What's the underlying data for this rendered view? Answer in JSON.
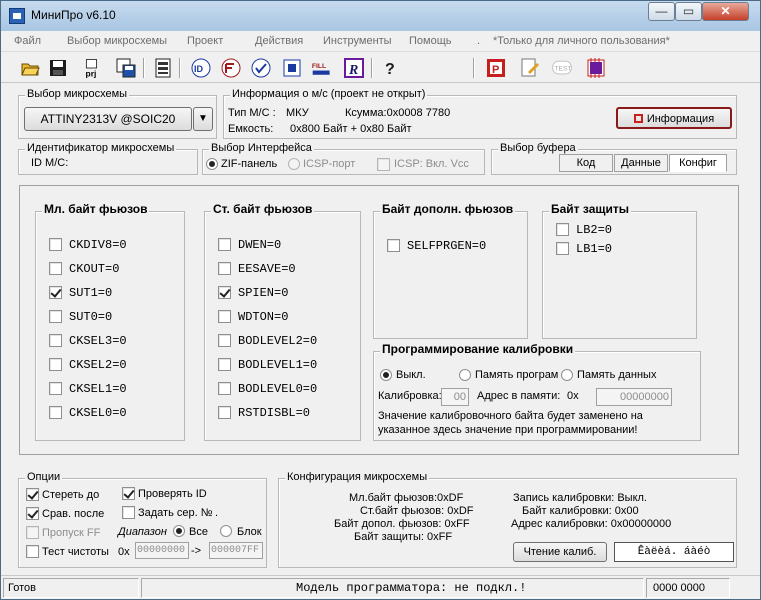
{
  "window": {
    "title": "МиниПро v6.10",
    "controls": {
      "minimize": "—",
      "maximize": "▭",
      "close": "✕"
    }
  },
  "menu": [
    "Файл",
    "Выбор микросхемы",
    "Проект",
    "Действия",
    "Инструменты",
    "Помощь",
    ".",
    "*Только для личного пользования*"
  ],
  "toolbar": {
    "icons": [
      "open-icon",
      "save-icon",
      "project-icon",
      "save-as-icon",
      "chip-info-icon",
      "read-id-icon",
      "read-icon",
      "verify-icon",
      "program-icon",
      "fill-icon",
      "read-protect-icon",
      "help-icon",
      "prog-mode-icon",
      "edit-icon",
      "test-icon",
      "chip-test-icon"
    ],
    "labels": {
      "prj": "prj",
      "fill": "FILL",
      "read_letter": "R",
      "help_mark": "?",
      "p_letter": "P",
      "test": "TEST",
      "id": "ID"
    }
  },
  "chip_select": {
    "label": "Выбор микросхемы",
    "value": "ATTINY2313V @SOIC20",
    "dropdown_arrow": "▼"
  },
  "chip_info": {
    "label": "Информация о м/с (проект не открыт)",
    "type_label": "Тип М/С :",
    "type_value": "МКУ",
    "checksum": "Ксумма:0x0008 7780",
    "capacity_label": "Емкость:",
    "capacity_value": "0x800 Байт  + 0x80 Байт",
    "info_button": "Информация"
  },
  "chip_id": {
    "label": "Идентификатор микросхемы",
    "id_label": "ID М/С:"
  },
  "interface": {
    "label": "Выбор Интерфейса",
    "zif": "ZIF-панель",
    "icsp": "ICSP-порт",
    "icsp_vcc": "ICSP: Вкл. Vcc"
  },
  "buffer": {
    "label": "Выбор буфера",
    "tabs": [
      "Код",
      "Данные",
      "Конфиг"
    ]
  },
  "fuses": {
    "low": {
      "title": "Мл. байт фьюзов",
      "items": [
        {
          "label": "CKDIV8=0",
          "checked": false
        },
        {
          "label": "CKOUT=0",
          "checked": false
        },
        {
          "label": "SUT1=0",
          "checked": true
        },
        {
          "label": "SUT0=0",
          "checked": false
        },
        {
          "label": "CKSEL3=0",
          "checked": false
        },
        {
          "label": "CKSEL2=0",
          "checked": false
        },
        {
          "label": "CKSEL1=0",
          "checked": false
        },
        {
          "label": "CKSEL0=0",
          "checked": false
        }
      ]
    },
    "high": {
      "title": "Ст. байт фьюзов",
      "items": [
        {
          "label": "DWEN=0",
          "checked": false
        },
        {
          "label": "EESAVE=0",
          "checked": false
        },
        {
          "label": "SPIEN=0",
          "checked": true
        },
        {
          "label": "WDTON=0",
          "checked": false
        },
        {
          "label": "BODLEVEL2=0",
          "checked": false
        },
        {
          "label": "BODLEVEL1=0",
          "checked": false
        },
        {
          "label": "BODLEVEL0=0",
          "checked": false
        },
        {
          "label": "RSTDISBL=0",
          "checked": false
        }
      ]
    },
    "ext": {
      "title": "Байт дополн. фьюзов",
      "items": [
        {
          "label": "SELFPRGEN=0",
          "checked": false
        }
      ]
    },
    "lock": {
      "title": "Байт защиты",
      "items": [
        {
          "label": "LB2=0",
          "checked": false
        },
        {
          "label": "LB1=0",
          "checked": false
        }
      ]
    }
  },
  "calibration": {
    "title": "Программирование калибровки",
    "off": "Выкл.",
    "prog_mem": "Память програм",
    "data_mem": "Память данных",
    "calib_label": "Калибровка:",
    "calib_value": "00",
    "addr_label": "Адрес в памяти:",
    "addr_prefix": "0x",
    "addr_value": "00000000",
    "note1": "Значение калибровочного байта будет заменено на",
    "note2": "указанное здесь значение при программировании!"
  },
  "options": {
    "label": "Опции",
    "erase": "Стереть до",
    "verify_after": "Срав. после",
    "skip_ff": "Пропуск FF",
    "blank_check": "Тест чистоты",
    "check_id": "Проверять ID",
    "serial": "Задать сер. №",
    "serial_dot": ".",
    "range_label": "Диапазон",
    "all": "Все",
    "block": "Блок",
    "range_prefix": "0x",
    "range_from": "00000000",
    "range_arrow": "->",
    "range_to": "000007FF"
  },
  "config": {
    "label": "Конфигурация микросхемы",
    "low_fuse": "Мл.байт фьюзов:0xDF",
    "high_fuse": "Ст.байт фьюзов: 0xDF",
    "ext_fuse": "Байт допол. фьюзов: 0xFF",
    "lock_byte": "Байт защиты:    0xFF",
    "calib_write": "Запись калибровки: Выкл.",
    "calib_byte": "Байт калибровки:    0x00",
    "calib_addr": "Адрес калибровки:    0x00000000",
    "read_calib_button": "Чтение калиб.",
    "encoded_field": "Êàëèá. áàéò"
  },
  "status": {
    "left": "Готов",
    "center": "Модель программатора:   не подкл.!",
    "right": "0000 0000"
  }
}
